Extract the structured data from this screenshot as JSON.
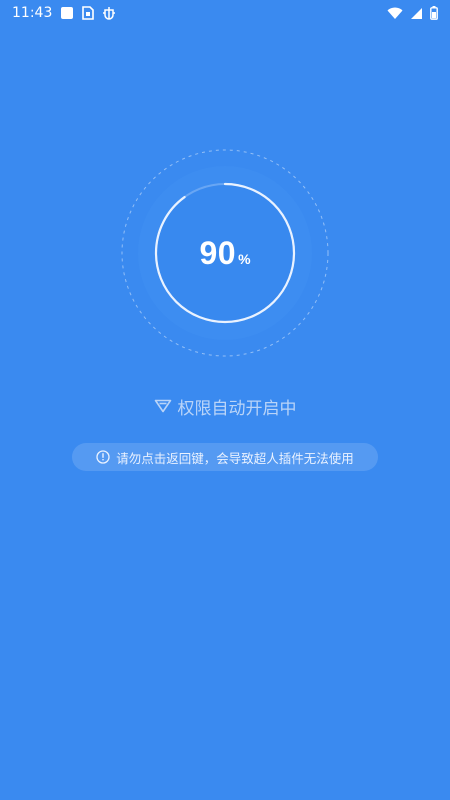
{
  "status_bar": {
    "time": "11:43",
    "left_icons": [
      "square-notification-icon",
      "sim-card-icon",
      "bug-app-icon"
    ],
    "right_icons": [
      "wifi-icon",
      "cell-signal-icon",
      "battery-icon"
    ]
  },
  "progress": {
    "value": "90",
    "unit": "%",
    "fraction": 0.9
  },
  "status": {
    "icon": "shield-icon",
    "text": "权限自动开启中"
  },
  "warning": {
    "icon": "info-circle-icon",
    "text": "请勿点击返回键，会导致超人插件无法使用"
  },
  "colors": {
    "background": "#3a8af0",
    "ring_track": "#68a6f4",
    "ring_progress": "#e9f2ff",
    "status_text": "#b9d4f8"
  }
}
